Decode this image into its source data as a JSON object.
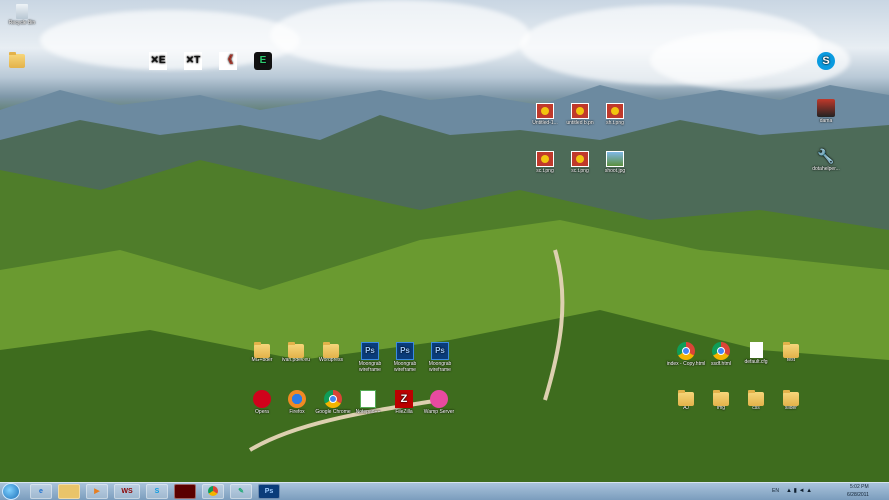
{
  "desktop_icons": {
    "recycle_bin": "Recycle Bin",
    "top_folder": "",
    "skype": "",
    "app1": "",
    "app2": "",
    "app3": "",
    "app4": "",
    "img1": "Untitled-1...",
    "img2": "untitled b.pn",
    "img3": "sh.t.png",
    "img4": "sc.t.png",
    "img5": "sc.t.png",
    "img6": "shoot.jpg",
    "dama": "dama",
    "dotahelper": "dotahelper...",
    "mg_folder1": "MG+bder",
    "mg_folder2": "ivan.pdev.eu",
    "mg_folder3": "Wordpress",
    "psd1": "Moongrab wireframe",
    "psd2": "Moongrab wireframe",
    "psd3": "Moongrab wireframe",
    "opera": "Opera",
    "firefox": "Firefox",
    "chrome": "Google Chrome",
    "notepad": "Notepad++",
    "filezilla": "FileZilla",
    "itunes": "Wamp Server",
    "index": "index - Copy.html",
    "ssdf": "ssdf.html",
    "default_cfg": "default.cfg",
    "test": "test",
    "aj": "AJ",
    "img": "img",
    "css": "css",
    "slider": "slider"
  },
  "taskbar": {
    "ws_label": "WS",
    "psd_label": "Ps",
    "lang": "EN",
    "time": "5:02 PM",
    "date": "6/28/2011"
  }
}
